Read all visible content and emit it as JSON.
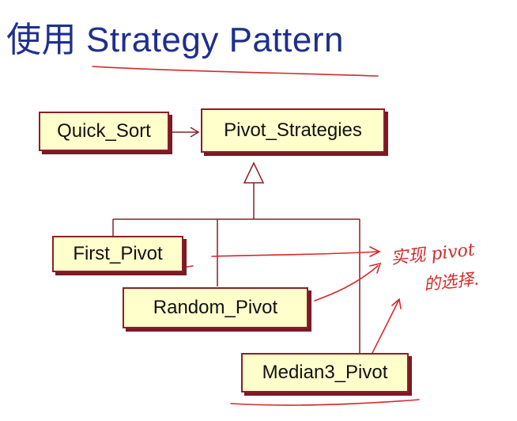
{
  "title": {
    "prefix": "使用",
    "main": "Strategy Pattern"
  },
  "diagram": {
    "classes": {
      "quick_sort": "Quick_Sort",
      "pivot_strategies": "Pivot_Strategies",
      "first_pivot": "First_Pivot",
      "random_pivot": "Random_Pivot",
      "median3_pivot": "Median3_Pivot"
    }
  },
  "annotation": {
    "line1": "实现 pivot",
    "line2": "的选择."
  },
  "colors": {
    "title": "#1f2f8c",
    "box_fill": "#ffffcc",
    "box_border": "#8b1f2a",
    "line": "#8b1f2a",
    "ink": "#d42a2a"
  }
}
